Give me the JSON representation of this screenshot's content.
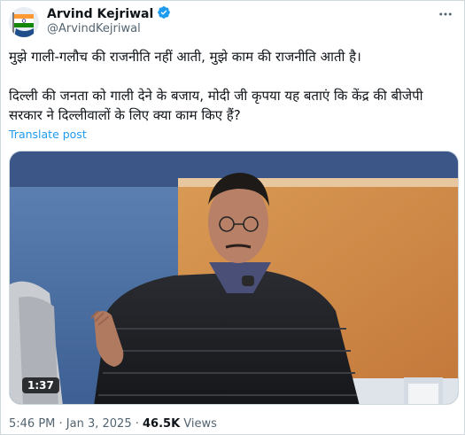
{
  "author": {
    "name": "Arvind Kejriwal",
    "handle": "@ArvindKejriwal",
    "verified": true
  },
  "more_icon": "more-horizontal-icon",
  "tweet": {
    "paragraph1": "मुझे गाली-गलौच की राजनीति नहीं आती, मुझे काम की राजनीति आती है।",
    "paragraph2": "दिल्ली की जनता को गाली देने के बजाय, मोदी जी कृपया यह बताएं कि केंद्र की बीजेपी सरकार ने दिल्लीवालों के लिए क्या काम किए हैं?",
    "translate_label": "Translate post"
  },
  "media": {
    "duration": "1:37"
  },
  "meta": {
    "time": "5:46 PM",
    "separator": " · ",
    "date": "Jan 3, 2025",
    "views_count": "46.5K",
    "views_label": " Views"
  },
  "colors": {
    "accent": "#1d9bf0",
    "verified": "#1d9bf0",
    "muted": "#536471"
  }
}
